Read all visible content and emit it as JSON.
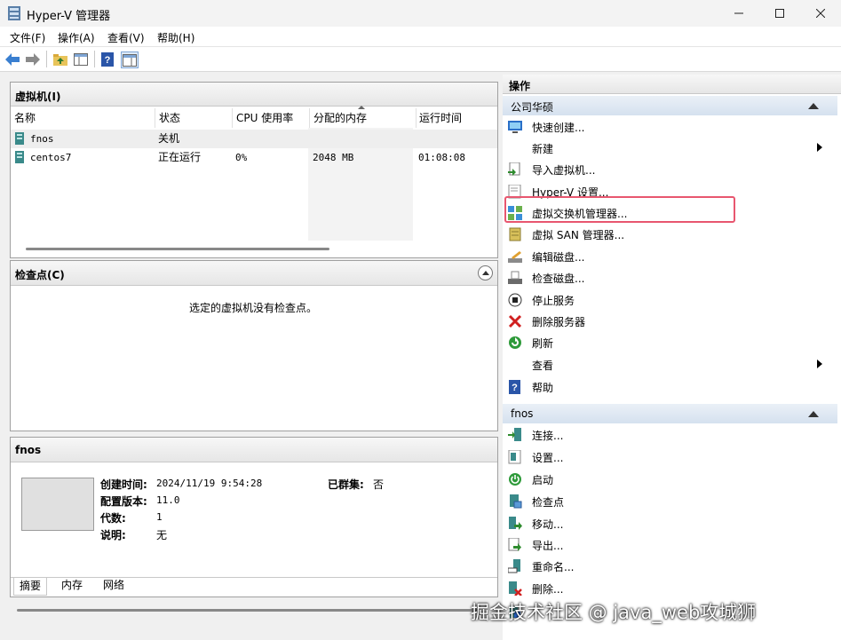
{
  "window": {
    "title": "Hyper-V 管理器"
  },
  "menu": [
    "文件(F)",
    "操作(A)",
    "查看(V)",
    "帮助(H)"
  ],
  "vm_panel": {
    "title": "虚拟机(I)",
    "columns": [
      "名称",
      "状态",
      "CPU 使用率",
      "分配的内存",
      "运行时间"
    ],
    "rows": [
      {
        "name": "fnos",
        "state": "关机",
        "cpu": "",
        "memory": "",
        "uptime": ""
      },
      {
        "name": "centos7",
        "state": "正在运行",
        "cpu": "0%",
        "memory": "2048 MB",
        "uptime": "01:08:08"
      }
    ]
  },
  "checkpoint_panel": {
    "title": "检查点(C)",
    "empty_text": "选定的虚拟机没有检查点。"
  },
  "details_panel": {
    "title": "fnos",
    "fields": [
      {
        "label": "创建时间:",
        "value": "2024/11/19 9:54:28"
      },
      {
        "label": "配置版本:",
        "value": "11.0"
      },
      {
        "label": "代数:",
        "value": "1"
      },
      {
        "label": "说明:",
        "value": "无"
      }
    ],
    "cluster": {
      "label": "已群集:",
      "value": "否"
    },
    "tabs": [
      "摘要",
      "内存",
      "网络"
    ]
  },
  "actions_panel": {
    "title": "操作",
    "server_section": {
      "title": "公司华硕",
      "items": [
        {
          "label": "快速创建...",
          "icon": "monitor-icon"
        },
        {
          "label": "新建",
          "icon": "none",
          "submenu": true
        },
        {
          "label": "导入虚拟机...",
          "icon": "import-icon"
        },
        {
          "label": "Hyper-V 设置...",
          "icon": "settings-page-icon"
        },
        {
          "label": "虚拟交换机管理器...",
          "icon": "switch-icon"
        },
        {
          "label": "虚拟 SAN 管理器...",
          "icon": "san-icon"
        },
        {
          "label": "编辑磁盘...",
          "icon": "edit-disk-icon"
        },
        {
          "label": "检查磁盘...",
          "icon": "inspect-disk-icon"
        },
        {
          "label": "停止服务",
          "icon": "stop-icon"
        },
        {
          "label": "删除服务器",
          "icon": "delete-x-icon"
        },
        {
          "label": "刷新",
          "icon": "refresh-icon"
        },
        {
          "label": "查看",
          "icon": "none",
          "submenu": true
        },
        {
          "label": "帮助",
          "icon": "help-icon"
        }
      ]
    },
    "vm_section": {
      "title": "fnos",
      "items": [
        {
          "label": "连接...",
          "icon": "connect-icon"
        },
        {
          "label": "设置...",
          "icon": "vm-settings-icon"
        },
        {
          "label": "启动",
          "icon": "power-icon"
        },
        {
          "label": "检查点",
          "icon": "checkpoint-icon"
        },
        {
          "label": "移动...",
          "icon": "move-icon"
        },
        {
          "label": "导出...",
          "icon": "export-icon"
        },
        {
          "label": "重命名...",
          "icon": "rename-icon"
        },
        {
          "label": "删除...",
          "icon": "delete-vm-icon"
        }
      ]
    }
  },
  "watermark": "掘金技术社区 @ java_web攻城狮",
  "colors": {
    "highlight": "#e8566f",
    "section_bg": "#d5e1ef",
    "accent_blue": "#1f6fc5"
  }
}
